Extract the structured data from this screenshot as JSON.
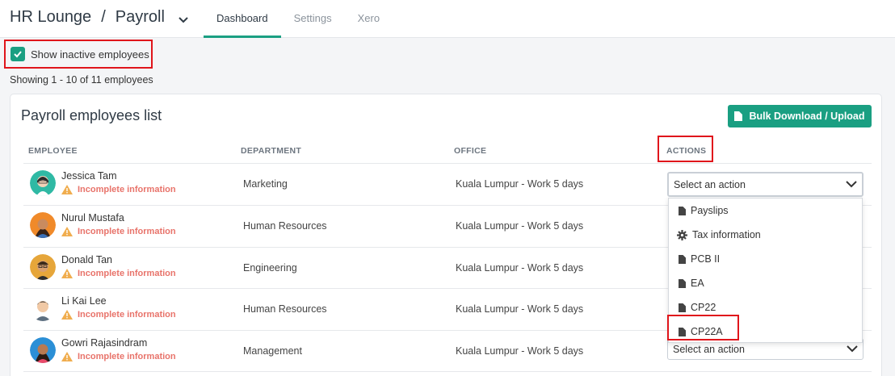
{
  "header": {
    "workspace": "HR Lounge",
    "separator": "/",
    "module": "Payroll",
    "tabs": [
      {
        "label": "Dashboard",
        "active": true
      },
      {
        "label": "Settings",
        "active": false
      },
      {
        "label": "Xero",
        "active": false
      }
    ]
  },
  "filters": {
    "show_inactive_label": "Show inactive employees",
    "show_inactive_checked": true
  },
  "summary": "Showing 1 - 10 of 11 employees",
  "card": {
    "title": "Payroll employees list",
    "bulk_button": "Bulk Download / Upload",
    "columns": [
      "EMPLOYEE",
      "DEPARTMENT",
      "OFFICE",
      "ACTIONS"
    ]
  },
  "employees": [
    {
      "name": "Jessica Tam",
      "status": "Incomplete information",
      "department": "Marketing",
      "office": "Kuala Lumpur - Work 5 days"
    },
    {
      "name": "Nurul Mustafa",
      "status": "Incomplete information",
      "department": "Human Resources",
      "office": "Kuala Lumpur - Work 5 days"
    },
    {
      "name": "Donald Tan",
      "status": "Incomplete information",
      "department": "Engineering",
      "office": "Kuala Lumpur - Work 5 days"
    },
    {
      "name": "Li Kai Lee",
      "status": "Incomplete information",
      "department": "Human Resources",
      "office": "Kuala Lumpur - Work 5 days"
    },
    {
      "name": "Gowri Rajasindram",
      "status": "Incomplete information",
      "department": "Management",
      "office": "Kuala Lumpur - Work 5 days"
    }
  ],
  "action_select": {
    "placeholder": "Select an action",
    "options": [
      {
        "label": "Payslips",
        "icon": "file-icon"
      },
      {
        "label": "Tax information",
        "icon": "gear-icon"
      },
      {
        "label": "PCB II",
        "icon": "file-icon"
      },
      {
        "label": "EA",
        "icon": "file-icon"
      },
      {
        "label": "CP22",
        "icon": "file-icon"
      },
      {
        "label": "CP22A",
        "icon": "file-icon"
      }
    ]
  },
  "colors": {
    "accent": "#1a9f82",
    "warning": "#e8736a",
    "highlight": "#e0151b"
  }
}
